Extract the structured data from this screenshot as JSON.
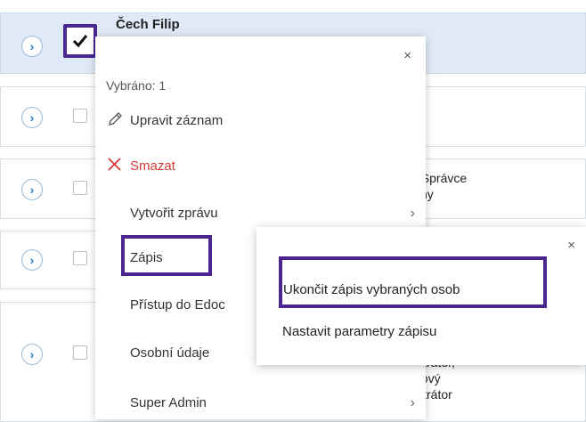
{
  "rows": [
    {
      "name": "Čech Filip",
      "selected": true,
      "text": []
    },
    {
      "name": "",
      "selected": false,
      "text": []
    },
    {
      "name": "",
      "selected": false,
      "text": [
        ", Správce",
        "vny"
      ]
    },
    {
      "name": "",
      "selected": false,
      "text": []
    },
    {
      "name": "",
      "selected": false,
      "text": [
        "istrator,",
        "nový",
        "istrátor"
      ]
    }
  ],
  "context_menu": {
    "close": "×",
    "selected_count": "Vybráno: 1",
    "items": [
      {
        "label": "Upravit záznam",
        "icon": "pencil-icon"
      },
      {
        "label": "Smazat",
        "icon": "delete-x-icon",
        "color": "#d23a3a"
      },
      {
        "label": "Vytvořit zprávu",
        "chevron": "›"
      },
      {
        "label": "Zápis"
      },
      {
        "label": "Přístup do Edoc"
      },
      {
        "label": "Osobní údaje"
      },
      {
        "label": "Super Admin",
        "chevron": "›"
      }
    ]
  },
  "submenu": {
    "close": "×",
    "items": [
      {
        "label": "Ukončit zápis vybraných osob"
      },
      {
        "label": "Nastavit parametry zápisu"
      }
    ]
  },
  "expand_glyph": "›",
  "colors": {
    "highlight": "#4b2590",
    "expand": "#2a7dc9",
    "danger": "#d23a3a",
    "selected_row": "#dfe9f7"
  }
}
